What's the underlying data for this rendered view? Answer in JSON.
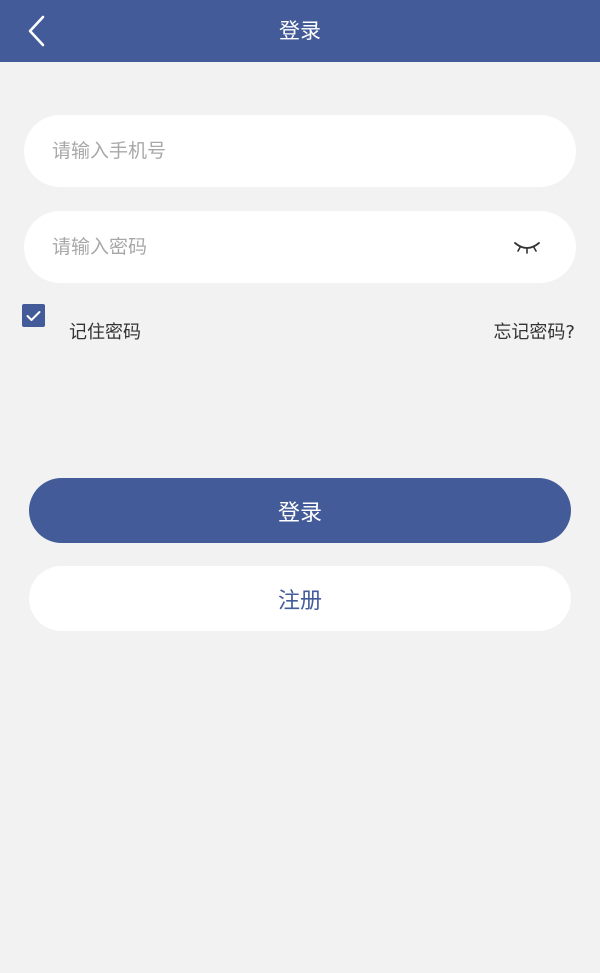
{
  "header": {
    "title": "登录"
  },
  "form": {
    "phone_placeholder": "请输入手机号",
    "phone_value": "",
    "password_placeholder": "请输入密码",
    "password_value": "",
    "password_visibility_icon": "eye-closed-icon",
    "remember_label": "记住密码",
    "remember_checked": true,
    "forgot_label": "忘记密码?"
  },
  "actions": {
    "login_label": "登录",
    "register_label": "注册"
  },
  "colors": {
    "primary": "#435c99",
    "background": "#f2f2f2",
    "card": "#ffffff",
    "placeholder": "#a8a8a8",
    "text": "#333333"
  }
}
